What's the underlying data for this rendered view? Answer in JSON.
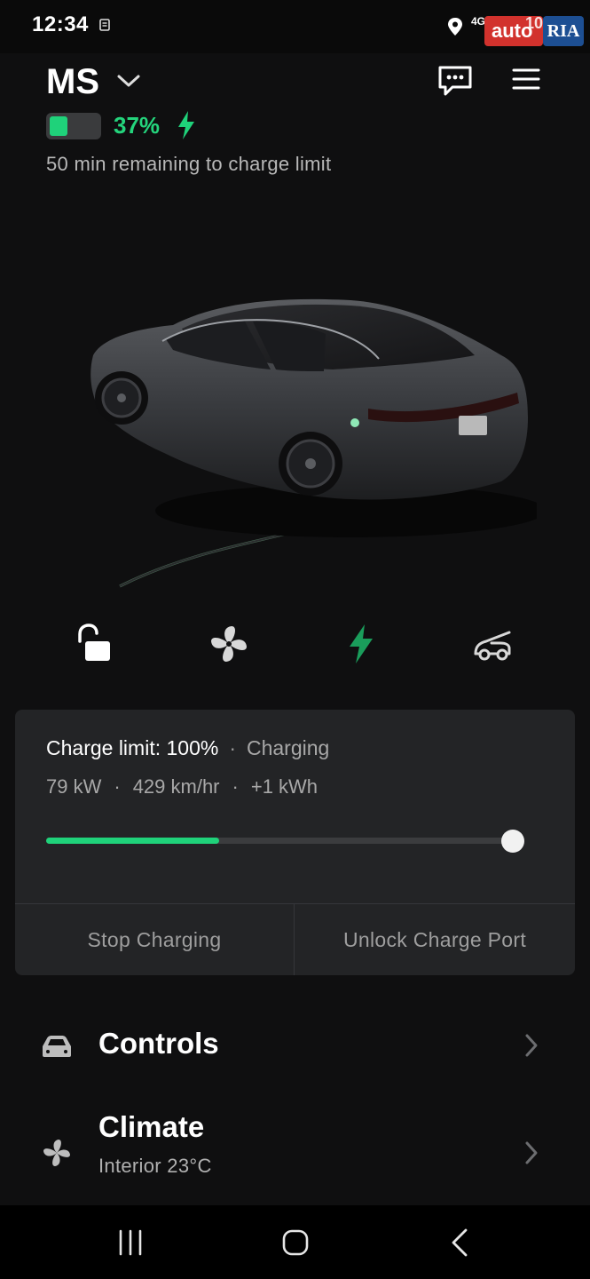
{
  "status_bar": {
    "time": "12:34",
    "network": "4G+",
    "watermark": {
      "brand_left": "auto",
      "brand_right": "RIA",
      "number": "100"
    }
  },
  "header": {
    "car_name": "MS",
    "battery_percent_text": "37%",
    "battery_level": 0.37,
    "remaining_text": "50 min remaining to charge limit"
  },
  "quick_actions": [
    {
      "name": "unlock",
      "icon": "unlocked-padlock-icon"
    },
    {
      "name": "climate",
      "icon": "fan-icon"
    },
    {
      "name": "charging",
      "icon": "lightning-bolt-icon"
    },
    {
      "name": "trunk",
      "icon": "car-trunk-icon"
    }
  ],
  "charge_card": {
    "limit_text": "Charge limit: 100%",
    "status_text": "Charging",
    "power": "79 kW",
    "rate": "429 km/hr",
    "added": "+1 kWh",
    "current_level": 0.37,
    "limit_level": 1.0,
    "stop_button": "Stop Charging",
    "unlock_button": "Unlock Charge Port"
  },
  "rows": [
    {
      "title": "Controls",
      "subtitle": "",
      "icon": "car-icon"
    },
    {
      "title": "Climate",
      "subtitle": "Interior 23°C",
      "icon": "fan-icon"
    }
  ],
  "nav": {
    "recent_icon": "recent-apps-icon",
    "home_icon": "home-icon",
    "back_icon": "back-icon"
  },
  "colors": {
    "background": "#0f0f10",
    "accent_green": "#1fd27a",
    "card": "#232426"
  }
}
